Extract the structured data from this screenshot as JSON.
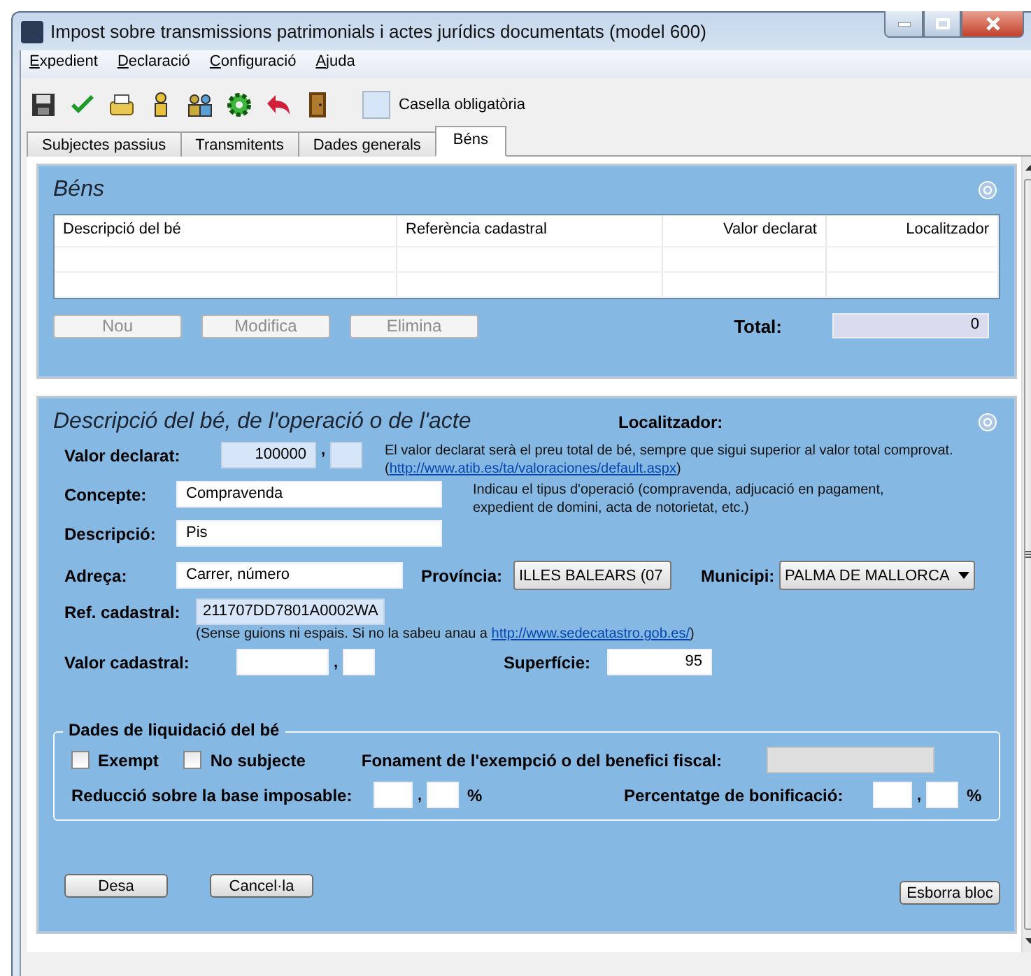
{
  "window": {
    "title": "Impost sobre transmissions patrimonials i actes jurídics documentats (model 600)"
  },
  "menu": [
    {
      "label": "Expedient"
    },
    {
      "label": "Declaració"
    },
    {
      "label": "Configuració"
    },
    {
      "label": "Ajuda"
    }
  ],
  "toolbar": {
    "legend": "Casella obligatòria"
  },
  "tabs": [
    {
      "label": "Subjectes passius",
      "selected": false
    },
    {
      "label": "Transmitents",
      "selected": false
    },
    {
      "label": "Dades generals",
      "selected": false
    },
    {
      "label": "Béns",
      "selected": true
    }
  ],
  "bens": {
    "title": "Béns",
    "columns": [
      "Descripció del bé",
      "Referència cadastral",
      "Valor declarat",
      "Localitzador"
    ],
    "buttons": [
      {
        "label": "Nou",
        "disabled": true
      },
      {
        "label": "Modifica",
        "disabled": true
      },
      {
        "label": "Elimina",
        "disabled": true
      }
    ],
    "total_label": "Total:",
    "total_value": "0"
  },
  "detail": {
    "title": "Descripció del bé, de l'operació o de l'acte",
    "localitzador_label": "Localitzador:",
    "valor_declarat": {
      "label": "Valor declarat:",
      "value": "100000",
      "required": true,
      "sep": ",",
      "decimals_required": true,
      "hint": "El valor declarat serà el preu total de bé, sempre que sigui superior al valor total comprovat.",
      "link_open": "(",
      "link": "http://www.atib.es/ta/valoraciones/default.aspx",
      "link_close": ")"
    },
    "concepte": {
      "label": "Concepte:",
      "value": "Compravenda",
      "hint": "Indicau el tipus d'operació (compravenda, adjucació en pagament, expedient de domini, acta de notorietat, etc.)"
    },
    "descripcio": {
      "label": "Descripció:",
      "value": "Pis"
    },
    "adreca": {
      "label": "Adreça:",
      "value": "Carrer, número"
    },
    "provincia": {
      "label": "Província:",
      "value": "ILLES BALEARS (07"
    },
    "municipi": {
      "label": "Municipi:",
      "value": "PALMA DE MALLORCA"
    },
    "ref_cadastral": {
      "label": "Ref. cadastral:",
      "value": "211707DD7801A0002WA",
      "required": true,
      "hint": "(Sense guions ni espais. Si no la sabeu anau a ",
      "link": "http://www.sedecatastro.gob.es/",
      "hint_end": ")"
    },
    "valor_cadastral": {
      "label": "Valor cadastral:",
      "sep": ","
    },
    "superficie": {
      "label": "Superfície:",
      "value": "95"
    },
    "liquidacio": {
      "title": "Dades de liquidació del bé",
      "checks": [
        {
          "label": "Exempt",
          "checked": false
        },
        {
          "label": "No subjecte",
          "checked": false
        }
      ],
      "fonament_label": "Fonament de l'exempció o del benefici fiscal:",
      "reduccio": {
        "label": "Reducció sobre la base imposable:",
        "sep": ",",
        "unit": "%"
      },
      "bonificacio": {
        "label": "Percentatge de bonificació:",
        "sep": ",",
        "unit": "%"
      }
    },
    "buttons": [
      {
        "label": "Desa"
      },
      {
        "label": "Cancel·la"
      }
    ],
    "clear_button": "Esborra bloc"
  }
}
